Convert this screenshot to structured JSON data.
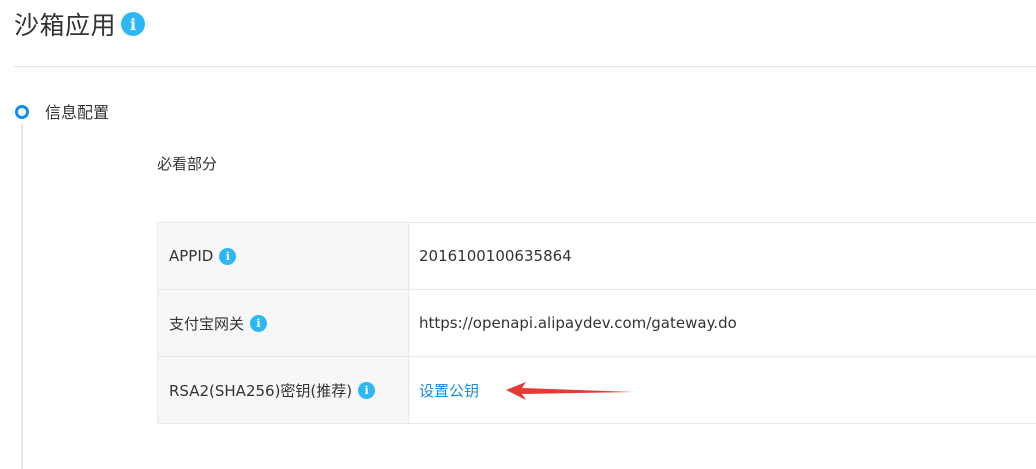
{
  "header": {
    "title": "沙箱应用",
    "info_icon": "info-icon"
  },
  "steps": [
    {
      "label": "信息配置",
      "icon": "step-circle-icon"
    }
  ],
  "section": {
    "title": "必看部分"
  },
  "table": {
    "rows": [
      {
        "label": "APPID",
        "value": "2016100100635864",
        "has_info": true
      },
      {
        "label": "支付宝网关",
        "value": "https://openapi.alipaydev.com/gateway.do",
        "has_info": true
      },
      {
        "label": "RSA2(SHA256)密钥(推荐)",
        "link": "设置公钥",
        "has_info": true
      }
    ]
  },
  "annotation": {
    "arrow_color": "#e53935",
    "icon": "red-arrow-annotation"
  },
  "colors": {
    "accent": "#108ee9",
    "info": "#2db7f5",
    "label_bg": "#f7f7f7",
    "border": "#e9e9e9"
  }
}
